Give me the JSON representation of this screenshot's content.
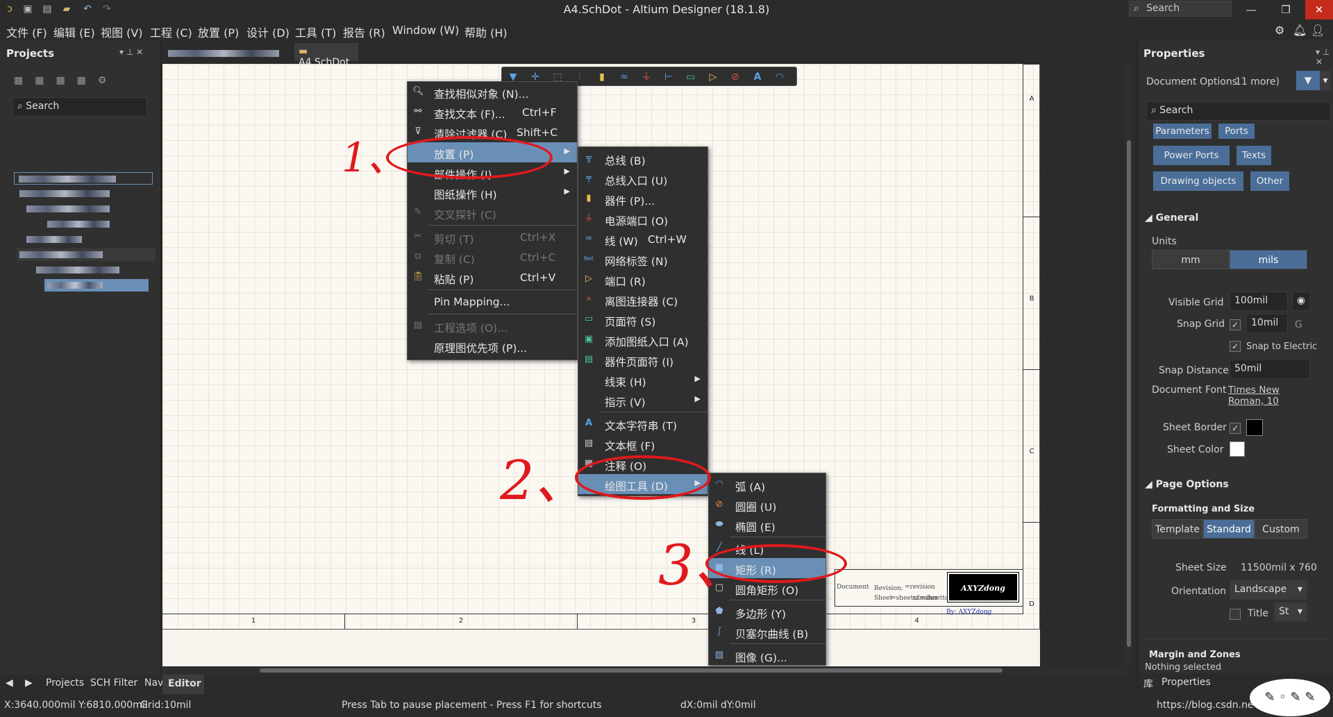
{
  "window": {
    "title": "A4.SchDot - Altium Designer (18.1.8)",
    "search_placeholder": "Search"
  },
  "menubar": [
    "文件 (F)",
    "编辑 (E)",
    "视图 (V)",
    "工程 (C)",
    "放置 (P)",
    "设计 (D)",
    "工具 (T)",
    "报告 (R)",
    "Window (W)",
    "帮助 (H)"
  ],
  "projects_panel": {
    "title": "Projects",
    "search_placeholder": "Search"
  },
  "doc_tab": {
    "label": "A4.SchDot"
  },
  "context_menu": {
    "items": [
      {
        "label": "查找相似对象 (N)...",
        "shortcut": "",
        "icon": "magnifier-icon",
        "disabled": false
      },
      {
        "label": "查找文本 (F)...",
        "shortcut": "Ctrl+F",
        "icon": "binoculars-icon",
        "disabled": false
      },
      {
        "label": "清除过滤器 (C)",
        "shortcut": "Shift+C",
        "icon": "clear-filter-icon",
        "disabled": false
      },
      {
        "label": "放置 (P)",
        "shortcut": "",
        "icon": "",
        "submenu": true,
        "highlighted": true
      },
      {
        "label": "部件操作 (I)",
        "shortcut": "",
        "icon": "",
        "submenu": true
      },
      {
        "label": "图纸操作 (H)",
        "shortcut": "",
        "icon": "",
        "submenu": true
      },
      {
        "label": "交叉探针 (C)",
        "shortcut": "",
        "icon": "probe-icon",
        "disabled": true
      },
      {
        "label": "剪切 (T)",
        "shortcut": "Ctrl+X",
        "icon": "cut-icon",
        "disabled": true
      },
      {
        "label": "复制 (C)",
        "shortcut": "Ctrl+C",
        "icon": "copy-icon",
        "disabled": true
      },
      {
        "label": "粘贴 (P)",
        "shortcut": "Ctrl+V",
        "icon": "paste-icon",
        "disabled": false
      },
      {
        "label": "Pin Mapping...",
        "shortcut": "",
        "icon": ""
      },
      {
        "label": "工程选项 (O)...",
        "shortcut": "",
        "icon": "project-options-icon",
        "disabled": true
      },
      {
        "label": "原理图优先项 (P)...",
        "shortcut": "",
        "icon": ""
      }
    ]
  },
  "place_submenu": {
    "items": [
      {
        "label": "总线 (B)",
        "shortcut": "",
        "icon": "bus-icon"
      },
      {
        "label": "总线入口 (U)",
        "shortcut": "",
        "icon": "bus-entry-icon"
      },
      {
        "label": "器件 (P)...",
        "shortcut": "",
        "icon": "part-icon"
      },
      {
        "label": "电源端口 (O)",
        "shortcut": "",
        "icon": "power-port-icon"
      },
      {
        "label": "线 (W)",
        "shortcut": "Ctrl+W",
        "icon": "wire-icon"
      },
      {
        "label": "网络标签 (N)",
        "shortcut": "",
        "icon": "net-label-icon"
      },
      {
        "label": "端口 (R)",
        "shortcut": "",
        "icon": "port-icon"
      },
      {
        "label": "离图连接器 (C)",
        "shortcut": "",
        "icon": "off-sheet-connector-icon"
      },
      {
        "label": "页面符 (S)",
        "shortcut": "",
        "icon": "sheet-symbol-icon"
      },
      {
        "label": "添加图纸入口 (A)",
        "shortcut": "",
        "icon": "sheet-entry-icon"
      },
      {
        "label": "器件页面符 (I)",
        "shortcut": "",
        "icon": "device-sheet-icon"
      },
      {
        "label": "线束 (H)",
        "shortcut": "",
        "icon": "",
        "submenu": true
      },
      {
        "label": "指示 (V)",
        "shortcut": "",
        "icon": "",
        "submenu": true
      },
      {
        "label": "文本字符串 (T)",
        "shortcut": "",
        "icon": "text-string-icon"
      },
      {
        "label": "文本框 (F)",
        "shortcut": "",
        "icon": "text-frame-icon"
      },
      {
        "label": "注释 (O)",
        "shortcut": "",
        "icon": "note-icon"
      },
      {
        "label": "绘图工具 (D)",
        "shortcut": "",
        "icon": "",
        "submenu": true,
        "highlighted": true
      }
    ]
  },
  "drawing_submenu": {
    "items": [
      {
        "label": "弧 (A)",
        "icon": "arc-icon"
      },
      {
        "label": "圆圈 (U)",
        "icon": "circle-icon"
      },
      {
        "label": "椭圆 (E)",
        "icon": "ellipse-icon"
      },
      {
        "label": "线 (L)",
        "icon": "line-icon"
      },
      {
        "label": "矩形 (R)",
        "icon": "rectangle-icon",
        "highlighted": true
      },
      {
        "label": "圆角矩形 (O)",
        "icon": "round-rectangle-icon"
      },
      {
        "label": "多边形 (Y)",
        "icon": "polygon-icon"
      },
      {
        "label": "贝塞尔曲线 (B)",
        "icon": "bezier-icon"
      },
      {
        "label": "图像 (G)...",
        "icon": "image-icon"
      }
    ]
  },
  "annotations": {
    "step1": "1、",
    "step2": "2、",
    "step3": "3、"
  },
  "sheet": {
    "zones_right": [
      "A",
      "B",
      "C",
      "D"
    ],
    "zones_bottom": [
      "1",
      "2",
      "3",
      "4"
    ],
    "titleblock": {
      "document": "Document",
      "revision": "Revision:",
      "revision_value": "=revision",
      "sheet": "Sheet",
      "sheet_value": "=sheetnumber",
      "of": "of",
      "of_value": "=sheettotal",
      "by": "By: AXYZdong",
      "logo": "AXYZdong"
    }
  },
  "properties_panel": {
    "title": "Properties",
    "doc_options": "Document Options",
    "more": "11 more)",
    "search_placeholder": "Search",
    "filter_buttons": [
      "Parameters",
      "Ports",
      "Power Ports",
      "Texts",
      "Drawing objects",
      "Other"
    ],
    "general": {
      "title": "General",
      "units_label": "Units",
      "unit_mm": "mm",
      "unit_mils": "mils",
      "visible_grid_label": "Visible Grid",
      "visible_grid": "100mil",
      "snap_grid_label": "Snap Grid",
      "snap_grid": "10mil",
      "snap_grid_key": "G",
      "snap_electric": "Snap to Electric",
      "snap_distance_label": "Snap Distance",
      "snap_distance": "50mil",
      "doc_font_label": "Document Font",
      "doc_font": "Times New Roman, 10",
      "sheet_border_label": "Sheet Border",
      "sheet_color_label": "Sheet Color"
    },
    "page_options": {
      "title": "Page Options",
      "formatting": "Formatting and Size",
      "tabs": [
        "Template",
        "Standard",
        "Custom"
      ],
      "sheet_size_label": "Sheet Size",
      "sheet_size": "11500mil x 760",
      "orientation_label": "Orientation",
      "orientation": "Landscape",
      "title_label": "Title",
      "title_select": "St",
      "margin_zones": "Margin and Zones"
    },
    "nothing_selected": "Nothing selected",
    "bottom_tab": "Properties"
  },
  "bottom_tabs": {
    "projects": "Projects",
    "sch_filter": "SCH Filter",
    "nav": "Nav",
    "editor": "Editor"
  },
  "status": {
    "coords": "X:3640.000mil Y:6810.000mil",
    "grid": "Grid:10mil",
    "hint": "Press Tab to pause placement - Press F1 for shortcuts",
    "delta": "dX:0mil dY:0mil",
    "watermark": "https://blog.csdn.ne"
  },
  "colors": {
    "highlight": "#6a8fb6",
    "accent_button": "#4a6e98",
    "annotation_red": "#e0191c"
  }
}
